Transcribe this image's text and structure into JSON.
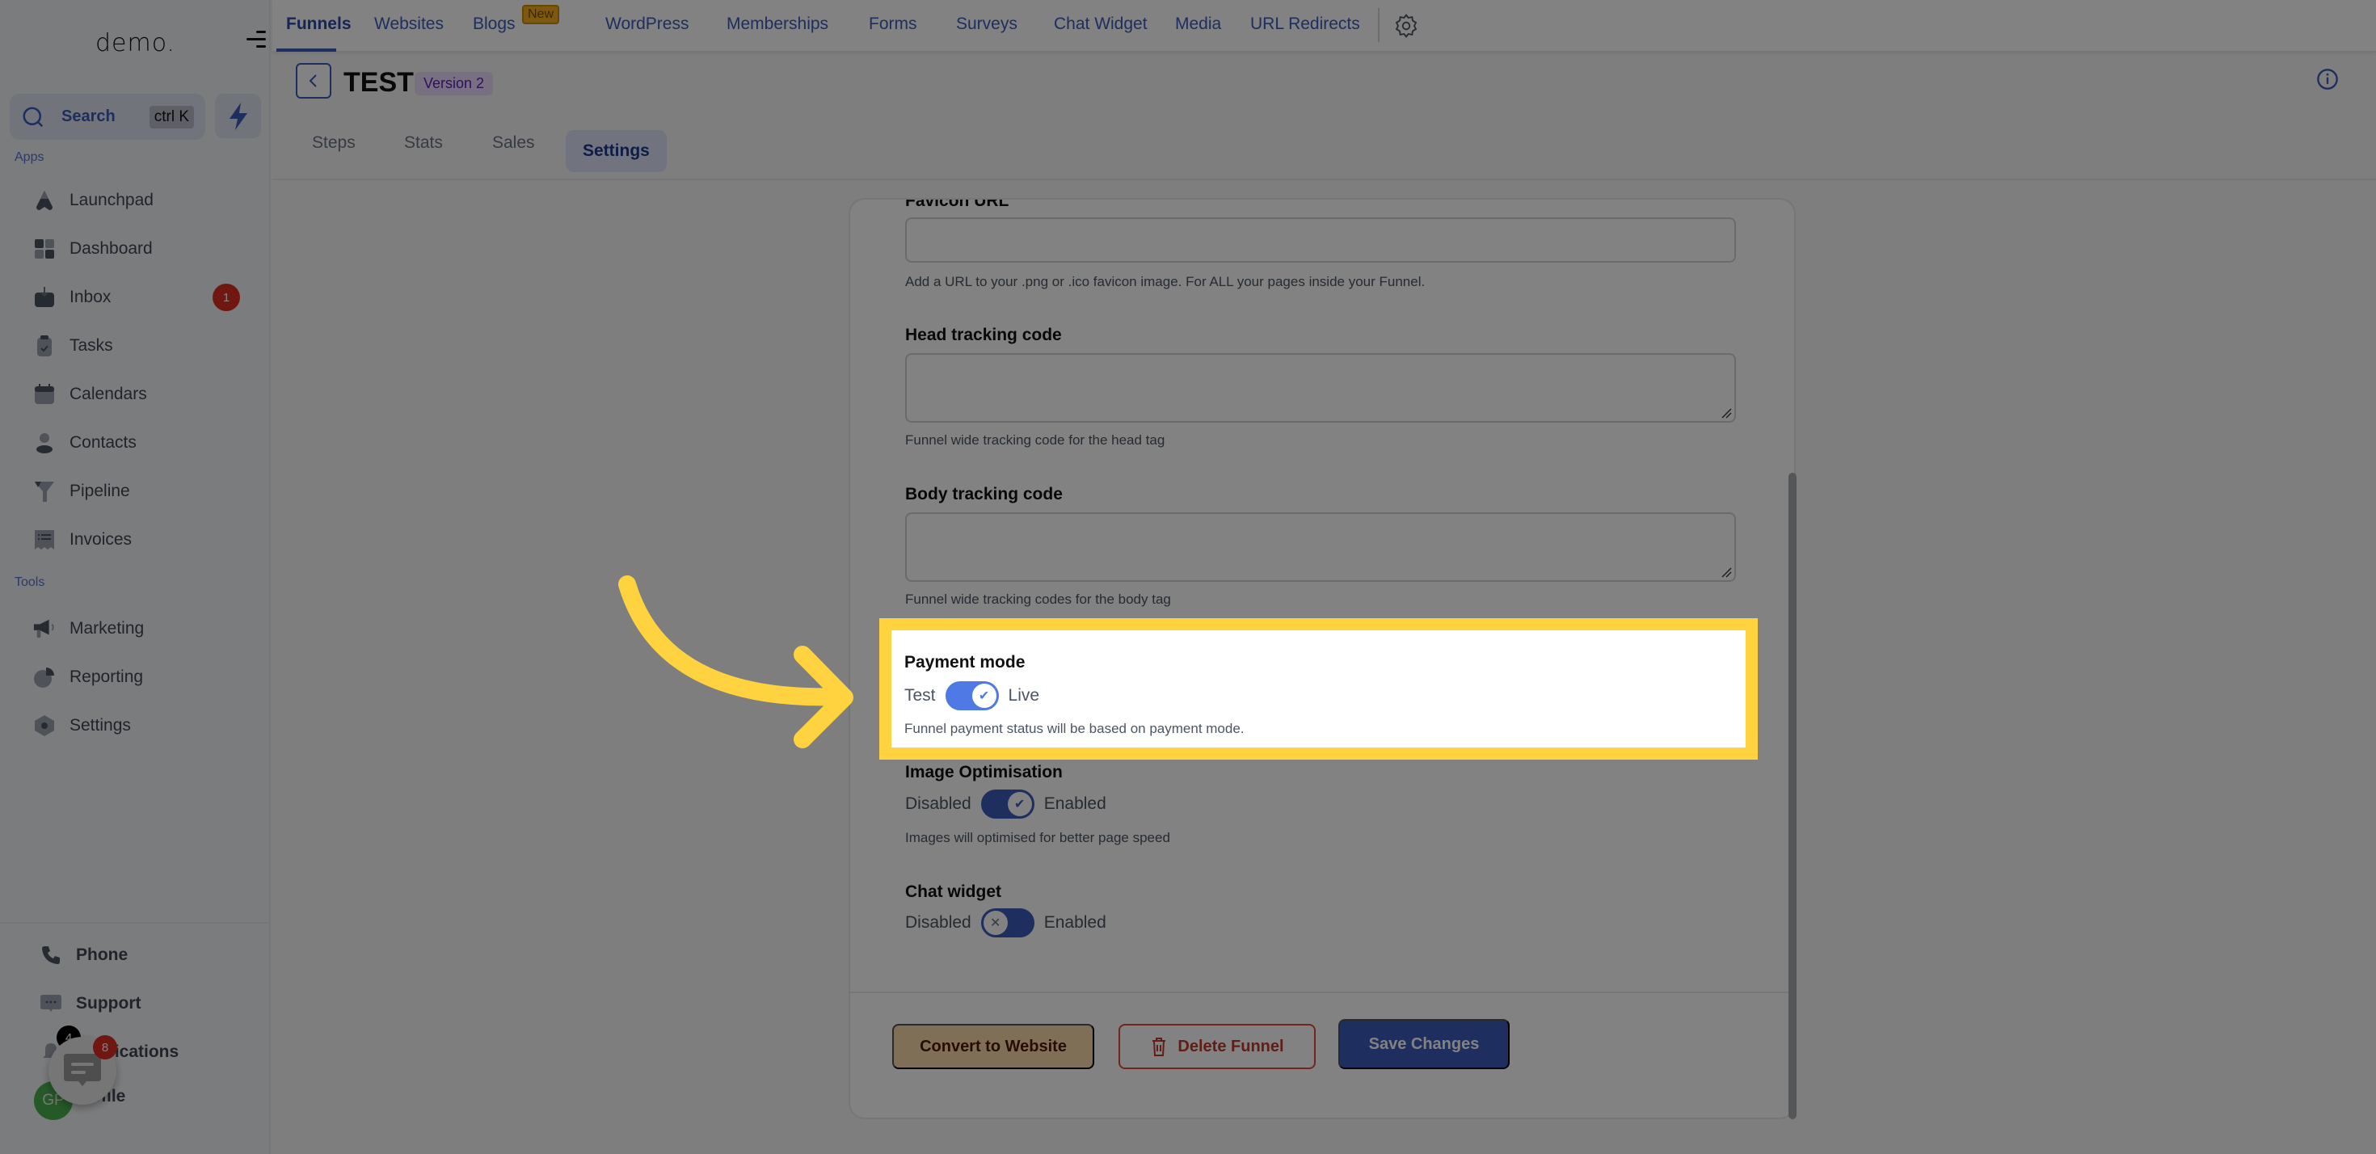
{
  "sidebar": {
    "logo": "demo.",
    "search": {
      "label": "Search",
      "shortcut": "ctrl K"
    },
    "sections": {
      "apps": "Apps",
      "tools": "Tools"
    },
    "apps": [
      {
        "label": "Launchpad",
        "icon": "rocket-icon"
      },
      {
        "label": "Dashboard",
        "icon": "dashboard-icon"
      },
      {
        "label": "Inbox",
        "icon": "inbox-icon",
        "badge": "1"
      },
      {
        "label": "Tasks",
        "icon": "clipboard-icon"
      },
      {
        "label": "Calendars",
        "icon": "calendar-icon"
      },
      {
        "label": "Contacts",
        "icon": "person-icon"
      },
      {
        "label": "Pipeline",
        "icon": "funnel-icon"
      },
      {
        "label": "Invoices",
        "icon": "invoice-icon"
      }
    ],
    "tools": [
      {
        "label": "Marketing",
        "icon": "megaphone-icon"
      },
      {
        "label": "Reporting",
        "icon": "pie-chart-icon"
      },
      {
        "label": "Settings",
        "icon": "settings-hex-icon"
      }
    ],
    "bottom": [
      {
        "label": "Phone",
        "icon": "phone-icon"
      },
      {
        "label": "Support",
        "icon": "chat-icon"
      },
      {
        "label": "Notifications",
        "icon": "bell-icon",
        "badge": "4"
      },
      {
        "label": "Profile",
        "avatar": "GP"
      }
    ],
    "chat_widget_badge": "8"
  },
  "topnav": {
    "tabs": [
      {
        "label": "Funnels",
        "active": true
      },
      {
        "label": "Websites"
      },
      {
        "label": "Blogs",
        "badge": "New"
      },
      {
        "label": "WordPress"
      },
      {
        "label": "Memberships"
      },
      {
        "label": "Forms"
      },
      {
        "label": "Surveys"
      },
      {
        "label": "Chat Widget"
      },
      {
        "label": "Media"
      },
      {
        "label": "URL Redirects"
      }
    ]
  },
  "header": {
    "title": "TEST",
    "version": "Version 2",
    "tabs": [
      {
        "label": "Steps"
      },
      {
        "label": "Stats"
      },
      {
        "label": "Sales"
      },
      {
        "label": "Settings",
        "active": true
      }
    ]
  },
  "settings": {
    "favicon": {
      "label": "Favicon URL",
      "value": "",
      "help": "Add a URL to your .png or .ico favicon image. For ALL your pages inside your Funnel."
    },
    "head_tracking": {
      "label": "Head tracking code",
      "value": "",
      "help": "Funnel wide tracking code for the head tag"
    },
    "body_tracking": {
      "label": "Body tracking code",
      "value": "",
      "help": "Funnel wide tracking codes for the body tag"
    },
    "payment_mode": {
      "label": "Payment mode",
      "off_label": "Test",
      "on_label": "Live",
      "enabled": true,
      "help": "Funnel payment status will be based on payment mode."
    },
    "image_optimisation": {
      "label": "Image Optimisation",
      "off_label": "Disabled",
      "on_label": "Enabled",
      "enabled": true,
      "help": "Images will optimised for better page speed"
    },
    "chat_widget": {
      "label": "Chat widget",
      "off_label": "Disabled",
      "on_label": "Enabled",
      "enabled": false
    }
  },
  "footer": {
    "convert": "Convert to Website",
    "delete": "Delete Funnel",
    "save": "Save Changes"
  },
  "colors": {
    "accent": "#3b5ab9",
    "highlight": "#ffd23f",
    "danger": "#dc4a3d",
    "convert_bg": "#fcd9ab"
  }
}
